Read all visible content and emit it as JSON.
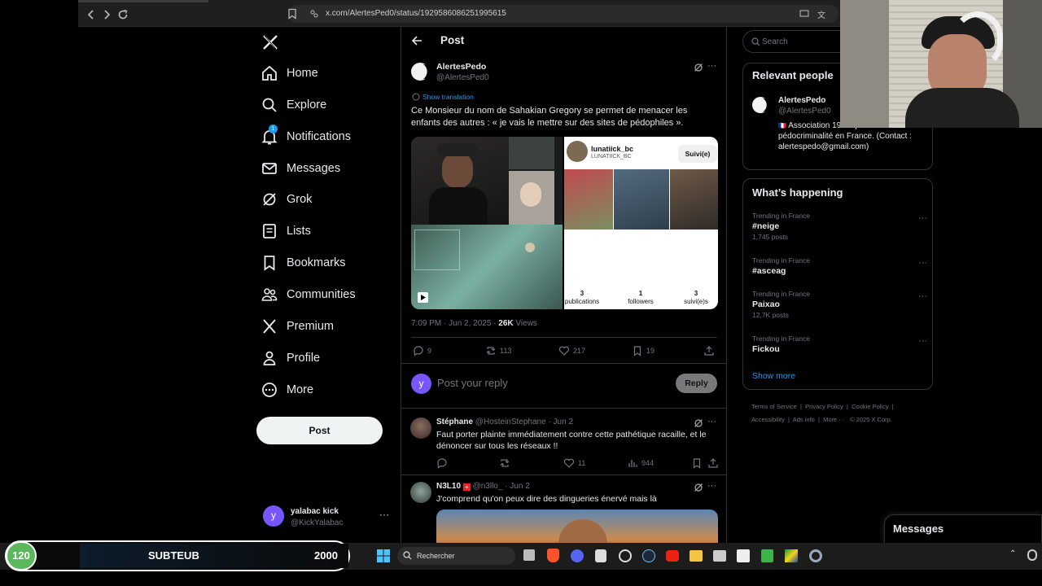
{
  "browser": {
    "url": "x.com/AlertesPed0/status/1929586086251995615"
  },
  "nav": {
    "items": [
      {
        "label": "Home",
        "icon": "home-icon"
      },
      {
        "label": "Explore",
        "icon": "search-icon"
      },
      {
        "label": "Notifications",
        "icon": "bell-icon",
        "badge": "1"
      },
      {
        "label": "Messages",
        "icon": "mail-icon"
      },
      {
        "label": "Grok",
        "icon": "grok-icon"
      },
      {
        "label": "Lists",
        "icon": "list-icon"
      },
      {
        "label": "Bookmarks",
        "icon": "bookmark-icon"
      },
      {
        "label": "Communities",
        "icon": "people-icon"
      },
      {
        "label": "Premium",
        "icon": "x-logo-icon"
      },
      {
        "label": "Profile",
        "icon": "person-icon"
      },
      {
        "label": "More",
        "icon": "more-circle-icon"
      }
    ],
    "post_button": "Post",
    "account": {
      "name": "yalabac kick",
      "handle": "@KickYalabac",
      "avatar_letter": "y"
    }
  },
  "post": {
    "header_title": "Post",
    "author_name": "AlertesPedo",
    "author_handle": "@AlertesPed0",
    "show_translation": "Show translation",
    "text": "Ce Monsieur du nom de Sahakian Gregory se permet de menacer les enfants des autres : « je vais le mettre sur des sites de pédophiles ».",
    "timestamp": "7:09 PM · Jun 2, 2025 · ",
    "views_count": "26K",
    "views_label": " Views",
    "stats": {
      "replies": "9",
      "reposts": "113",
      "likes": "217",
      "bookmarks": "19"
    },
    "media": {
      "profile_name": "lunatiick_bc",
      "profile_handle": "LUNATIICK_BC",
      "follow_label": "Suivi(e)",
      "stats": [
        {
          "value": "3",
          "label": "publications"
        },
        {
          "value": "1",
          "label": "followers"
        },
        {
          "value": "3",
          "label": "suivi(e)s"
        }
      ]
    }
  },
  "reply_box": {
    "avatar_letter": "y",
    "placeholder": "Post your reply",
    "button": "Reply"
  },
  "replies": [
    {
      "name": "Stéphane",
      "handle": "@HosteinStephane",
      "date": "· Jun 2",
      "text": "Faut porter plainte immédiatement contre cette pathétique racaille, et le dénoncer sur tous les réseaux !!",
      "likes": "11",
      "views": "944"
    },
    {
      "name": "N3L10",
      "handle": "@n3llo_",
      "date": "· Jun 2",
      "text": "J'comprend qu'on peux dire des dingueries énervé mais là"
    }
  ],
  "right": {
    "search_placeholder": "Search",
    "relevant_title": "Relevant people",
    "relevant": {
      "name": "AlertesPedo",
      "handle": "@AlertesPed0",
      "bio": "Association 1901 qui lutte contre la pédocriminalité en France. (Contact : alertespedo@gmail.com)"
    },
    "happening_title": "What’s happening",
    "trends": [
      {
        "meta": "Trending in France",
        "name": "#neige",
        "count": "1,745 posts"
      },
      {
        "meta": "Trending in France",
        "name": "#asceag",
        "count": ""
      },
      {
        "meta": "Trending in France",
        "name": "Paixao",
        "count": "12.7K posts"
      },
      {
        "meta": "Trending in France",
        "name": "Fickou",
        "count": ""
      }
    ],
    "show_more": "Show more",
    "footer": [
      "Terms of Service",
      "Privacy Policy",
      "Cookie Policy",
      "Accessibility",
      "Ads info",
      "More ···",
      "© 2025 X Corp."
    ],
    "messages_title": "Messages"
  },
  "overlay": {
    "level": "120",
    "label": "SUBTEUB",
    "goal": "2000"
  },
  "taskbar": {
    "search_placeholder": "Rechercher"
  },
  "colors": {
    "accent": "#1d9bf0",
    "reply_avatar": "#7856ff",
    "level_badge": "#5cb85c"
  }
}
